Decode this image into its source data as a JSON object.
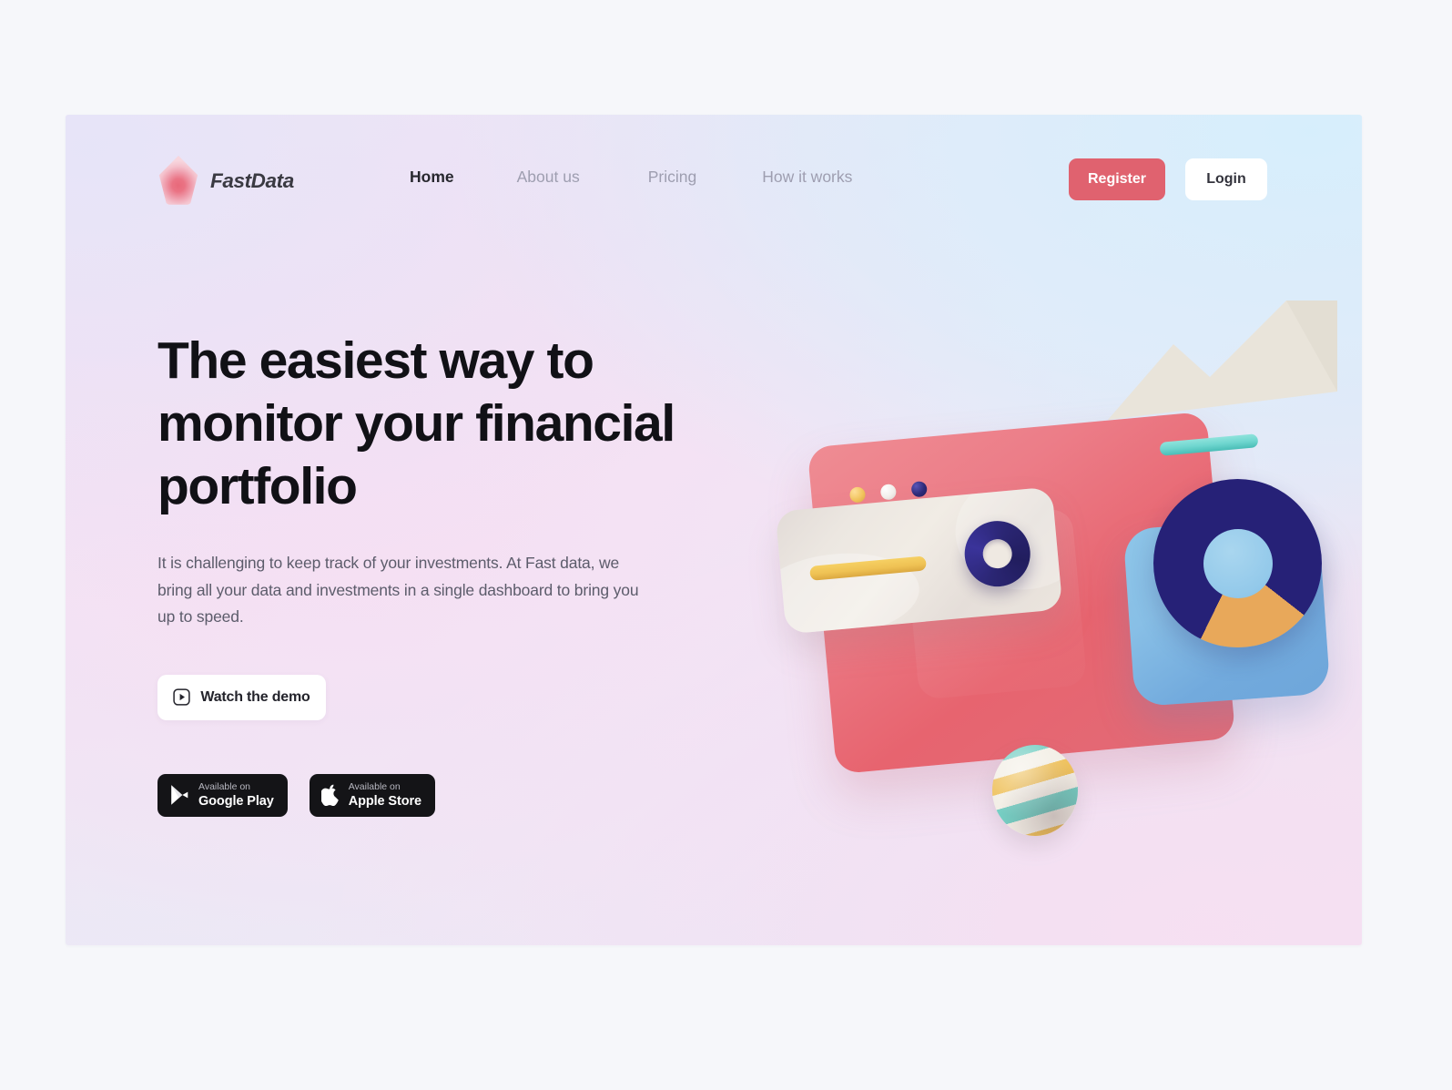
{
  "brand": {
    "name": "FastData",
    "logo_icon": "teardrop-logo-icon",
    "logo_color": "#e8697a"
  },
  "nav": {
    "links": [
      {
        "label": "Home",
        "active": true
      },
      {
        "label": "About us",
        "active": false
      },
      {
        "label": "Pricing",
        "active": false
      },
      {
        "label": "How it works",
        "active": false
      }
    ],
    "register_label": "Register",
    "login_label": "Login",
    "register_color": "#e0626f",
    "login_color": "#ffffff"
  },
  "hero": {
    "headline": "The easiest way to monitor your financial portfolio",
    "subcopy": "It is challenging to keep track of your investments. At Fast data, we bring all your data and investments in a single dashboard to bring you up to speed.",
    "demo_button": {
      "label": "Watch the demo",
      "icon": "play-square-icon"
    }
  },
  "stores": [
    {
      "icon": "google-play-icon",
      "small": "Available on",
      "big": "Google Play"
    },
    {
      "icon": "apple-icon",
      "small": "Available on",
      "big": "Apple Store"
    }
  ],
  "illustration": {
    "name": "financial-dashboard-3d-illustration",
    "window_color": "#e7646f",
    "traffic_dots": [
      "#f2c55e",
      "#f3f0ec",
      "#2e2a78"
    ],
    "beige_card_color": "#ece7e1",
    "yellow_pill_color": "#efc254",
    "torus_color": "#2b2674",
    "zigzag_color": "#e9e4da",
    "teal_pill_color": "#6fd6cf",
    "blue_card_color": "#88bfe6",
    "donut_colors": [
      "#262177",
      "#e8a85a",
      "#93c9ea"
    ],
    "sphere_colors": [
      "#efc25e",
      "#f3efe6",
      "#76cfc4"
    ]
  }
}
